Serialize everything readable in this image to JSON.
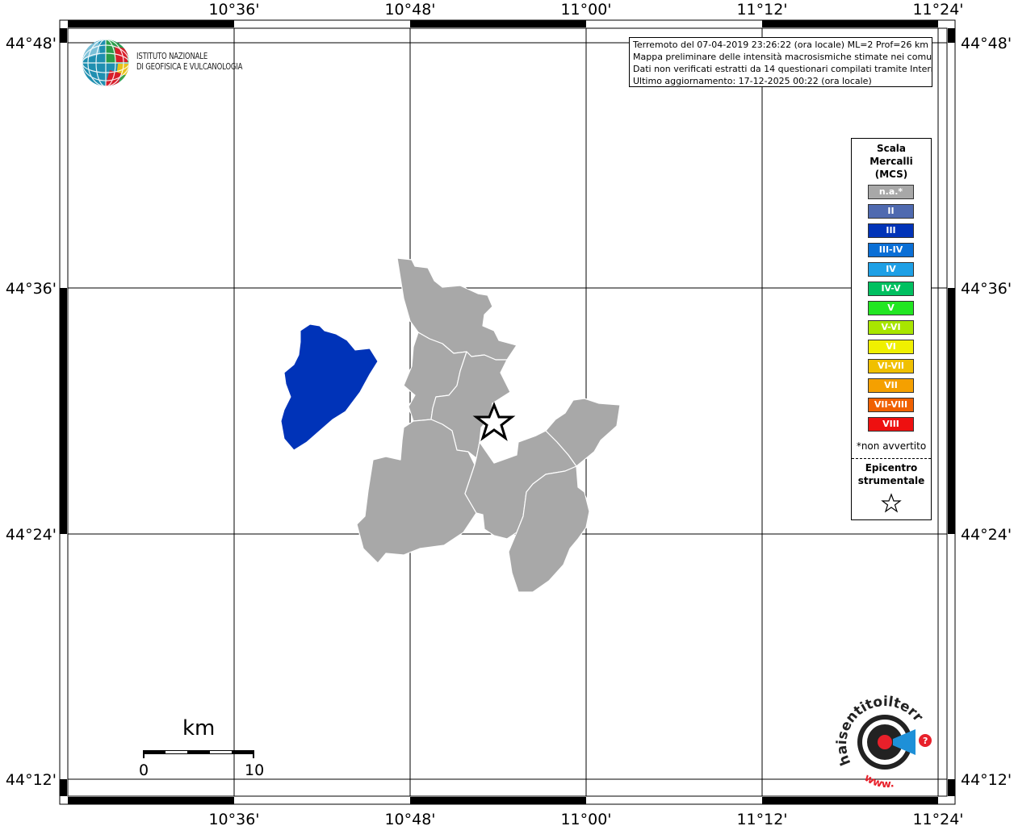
{
  "title_box": {
    "line1": "Terremoto del 07-04-2019 23:26:22 (ora locale) ML=2 Prof=26 km",
    "line2": "Mappa preliminare delle intensità macrosismiche stimate nei comuni",
    "line3": "Dati non verificati estratti da 14 questionari compilati tramite Internet.",
    "line4": "Ultimo aggiornamento: 17-12-2025 00:22 (ora locale)"
  },
  "institute": {
    "line1": "ISTITUTO NAZIONALE",
    "line2": "DI GEOFISICA E VULCANOLOGIA"
  },
  "lon_labels": [
    "10°36'",
    "10°48'",
    "11°00'",
    "11°12'",
    "11°24'"
  ],
  "lat_labels": [
    "44°48'",
    "44°36'",
    "44°24'",
    "44°12'"
  ],
  "legend": {
    "title1": "Scala",
    "title2": "Mercalli",
    "title3": "(MCS)",
    "classes": [
      {
        "label": "n.a.*",
        "color": "#a8a8a8"
      },
      {
        "label": "II",
        "color": "#4f6ab0"
      },
      {
        "label": "III",
        "color": "#0033b8"
      },
      {
        "label": "III-IV",
        "color": "#0a6fd6"
      },
      {
        "label": "IV",
        "color": "#1ea0e6"
      },
      {
        "label": "IV-V",
        "color": "#00c060"
      },
      {
        "label": "V",
        "color": "#22e622"
      },
      {
        "label": "V-VI",
        "color": "#a8e600"
      },
      {
        "label": "VI",
        "color": "#f0f000"
      },
      {
        "label": "VI-VII",
        "color": "#f0c000"
      },
      {
        "label": "VII",
        "color": "#f5a000"
      },
      {
        "label": "VII-VIII",
        "color": "#f06000"
      },
      {
        "label": "VIII",
        "color": "#ee1010"
      }
    ],
    "note": "*non avvertito",
    "epicenter1": "Epicentro",
    "epicenter2": "strumentale"
  },
  "scalebar": {
    "unit": "km",
    "start": "0",
    "end": "10"
  },
  "map_colors": {
    "na_fill": "#a8a8a8",
    "iii_fill": "#0033b8",
    "grid": "#000000"
  },
  "hst_logo": {
    "main": "haisentitoilterremoto.it",
    "sub": "www."
  }
}
